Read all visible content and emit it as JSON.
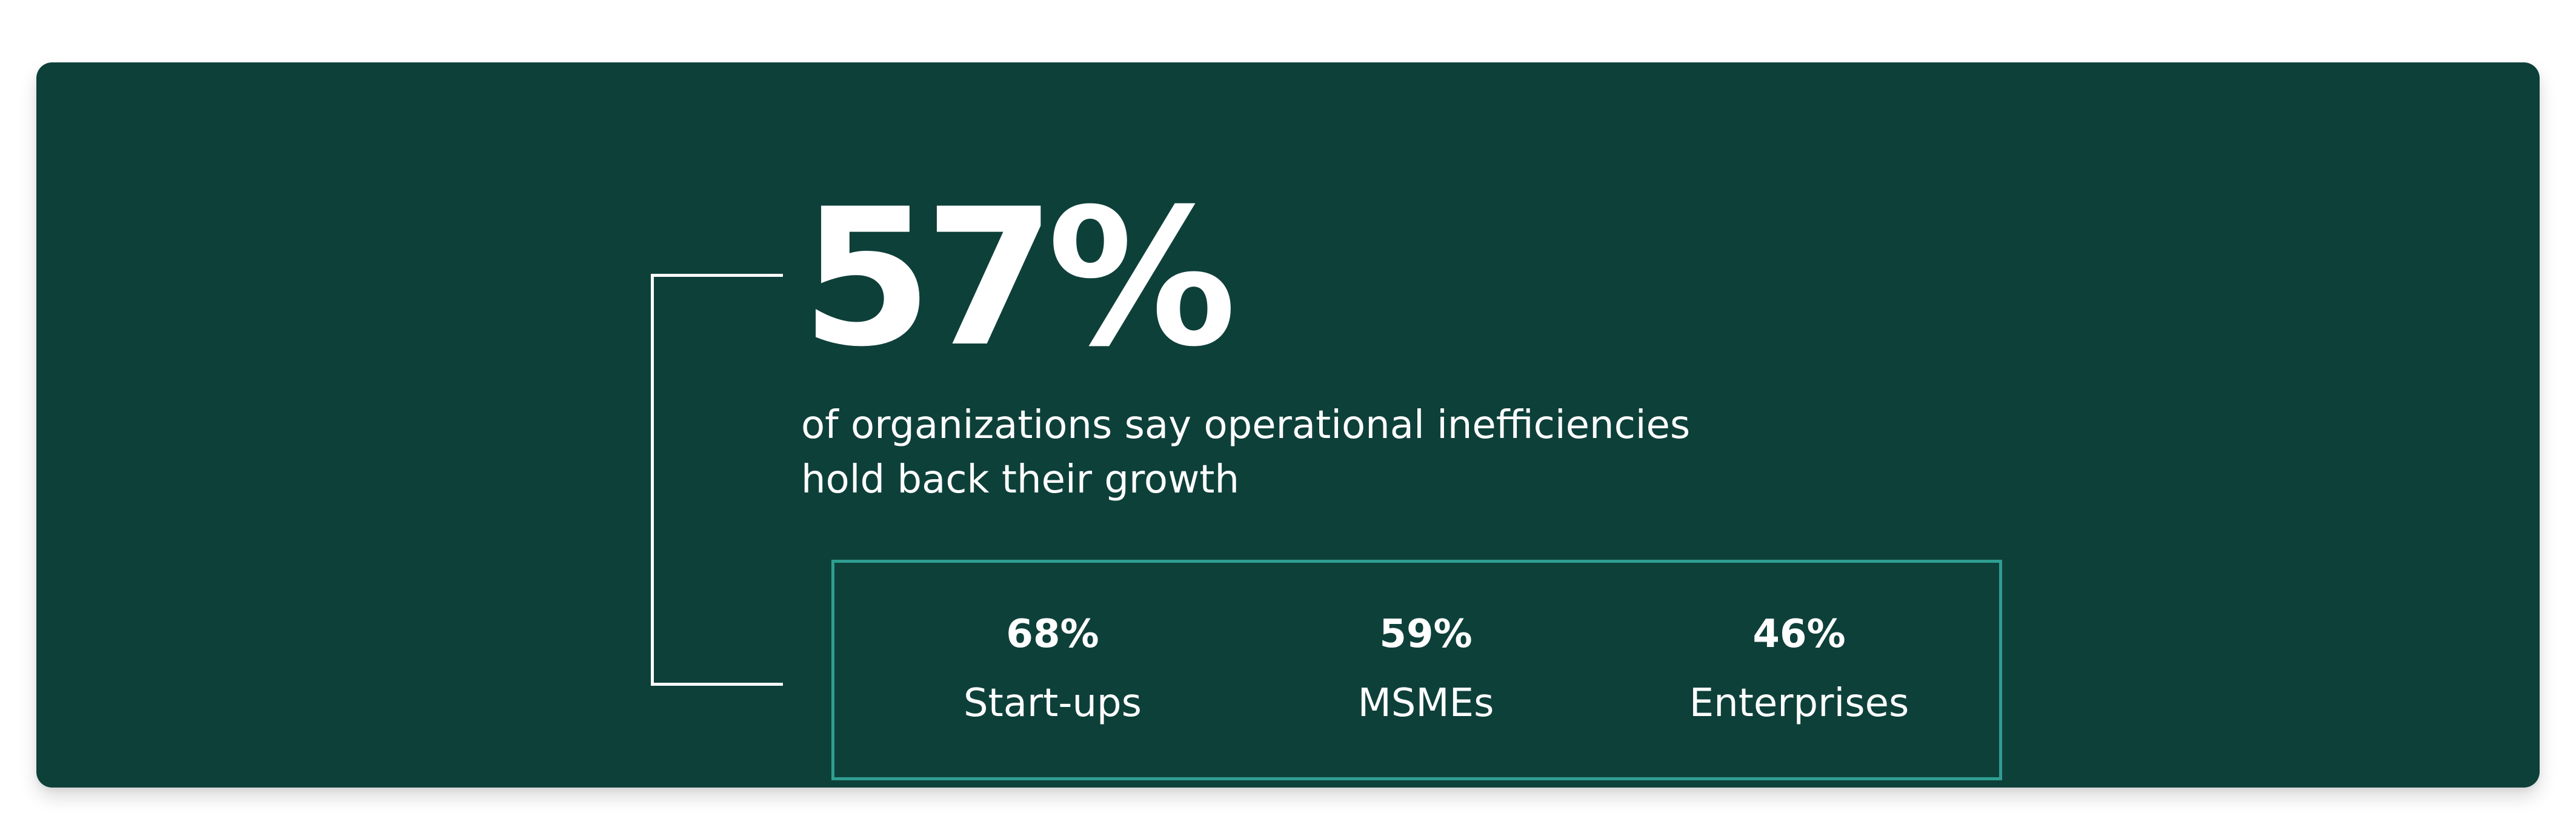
{
  "colors": {
    "card_background": "#0e403a",
    "text": "#ffffff",
    "bracket_line": "#ffffff",
    "box_border": "#2f9e92"
  },
  "headline": {
    "value": "57%",
    "subtitle_line1": "of organizations say operational inefficiencies",
    "subtitle_line2": "hold back their growth"
  },
  "breakdown": [
    {
      "value": "68%",
      "label": "Start-ups"
    },
    {
      "value": "59%",
      "label": "MSMEs"
    },
    {
      "value": "46%",
      "label": "Enterprises"
    }
  ]
}
